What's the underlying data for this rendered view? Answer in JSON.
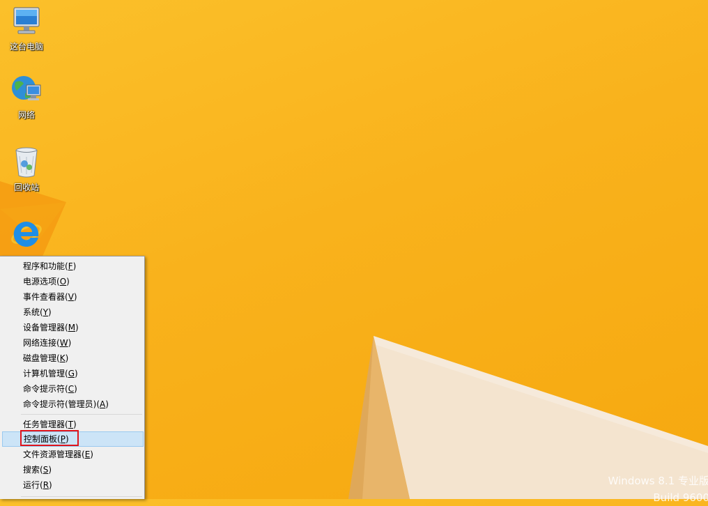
{
  "desktop": {
    "icons": [
      {
        "label": "这台电脑",
        "icon": "computer-icon"
      },
      {
        "label": "网络",
        "icon": "network-icon"
      },
      {
        "label": "回收站",
        "icon": "recycle-bin-icon"
      },
      {
        "label": "",
        "icon": "internet-explorer-icon"
      }
    ],
    "watermark": {
      "line1": "Windows 8.1 专业版",
      "line2": "Build 9600"
    },
    "colors": {
      "wallpaper": "#f9b21c",
      "menu_highlight": "#cce4f7",
      "callout": "#e0141b"
    }
  },
  "context_menu": {
    "groups": [
      [
        {
          "text": "程序和功能",
          "key": "F"
        },
        {
          "text": "电源选项",
          "key": "O"
        },
        {
          "text": "事件查看器",
          "key": "V"
        },
        {
          "text": "系统",
          "key": "Y"
        },
        {
          "text": "设备管理器",
          "key": "M"
        },
        {
          "text": "网络连接",
          "key": "W"
        },
        {
          "text": "磁盘管理",
          "key": "K"
        },
        {
          "text": "计算机管理",
          "key": "G"
        },
        {
          "text": "命令提示符",
          "key": "C"
        },
        {
          "text": "命令提示符(管理员)",
          "key": "A"
        }
      ],
      [
        {
          "text": "任务管理器",
          "key": "T"
        },
        {
          "text": "控制面板",
          "key": "P",
          "highlighted": true
        },
        {
          "text": "文件资源管理器",
          "key": "E"
        },
        {
          "text": "搜索",
          "key": "S"
        },
        {
          "text": "运行",
          "key": "R"
        }
      ]
    ]
  }
}
